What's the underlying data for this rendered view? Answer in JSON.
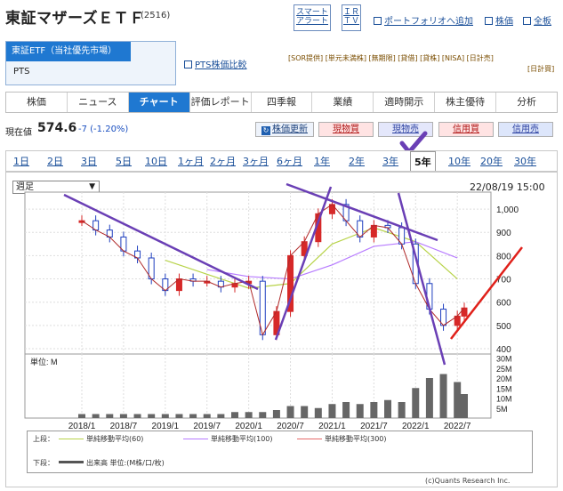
{
  "header": {
    "title": "東証マザーズＥＴＦ",
    "code": "(2516)",
    "smart_alert": "スマート\nアラート",
    "ir_tv": "ＩＲ\nＴＶ",
    "portfolio_link": "ポートフォリオへ追加",
    "stock_price_link": "株価",
    "all_board_link": "全板"
  },
  "market": {
    "selected": "東証ETF（当社優先市場）",
    "pts": "PTS",
    "pts_compare": "PTS株価比較",
    "tags_row1": "[SOR提供] [単元未満株] [無期限] [貸借] [貸株] [NISA] [日計売]",
    "tags_row2": "[日計買]"
  },
  "tabs": [
    "株価",
    "ニュース",
    "チャート",
    "評価レポート",
    "四季報",
    "業績",
    "適時開示",
    "株主優待",
    "分析"
  ],
  "quote": {
    "label": "現在値",
    "price": "574.6",
    "change": "-7 (-1.20%)"
  },
  "actions": {
    "refresh": "株価更新",
    "buy_spot": "現物買",
    "sell_spot": "現物売",
    "buy_margin": "信用買",
    "sell_margin": "信用売"
  },
  "periods": [
    "1日",
    "2日",
    "3日",
    "5日",
    "10日",
    "1ヶ月",
    "2ヶ月",
    "3ヶ月",
    "6ヶ月",
    "1年",
    "2年",
    "3年",
    "5年",
    "10年",
    "20年",
    "30年"
  ],
  "active_period": "5年",
  "chart_controls": {
    "span": "週足",
    "date": "22/08/19 15:00"
  },
  "colors": {
    "accent": "#1f78d1",
    "ma60": "#b8d34a",
    "ma100": "#b77bff",
    "ma300": "#e66a6a",
    "up": "#d62828",
    "down": "#1f3fbf",
    "annotation_purple": "#6a3fb5",
    "annotation_red": "#e0201a"
  },
  "chart_data": {
    "type": "line",
    "x_ticks": [
      "2018/1",
      "2018/7",
      "2019/1",
      "2019/7",
      "2020/1",
      "2020/7",
      "2021/1",
      "2021/7",
      "2022/1",
      "2022/7"
    ],
    "price_ticks": [
      "1,000",
      "900",
      "800",
      "700",
      "600",
      "500",
      "400"
    ],
    "ylim": [
      400,
      1050
    ],
    "volume_ticks": [
      "30M",
      "25M",
      "20M",
      "15M",
      "10M",
      "5M"
    ],
    "volume_unit": "単位: M",
    "price_series": {
      "name": "東証マザーズＥＴＦ",
      "x": [
        "2018/1",
        "2018/3",
        "2018/5",
        "2018/7",
        "2018/9",
        "2018/11",
        "2019/1",
        "2019/3",
        "2019/5",
        "2019/7",
        "2019/9",
        "2019/11",
        "2020/1",
        "2020/3",
        "2020/5",
        "2020/7",
        "2020/9",
        "2020/11",
        "2021/1",
        "2021/3",
        "2021/5",
        "2021/7",
        "2021/9",
        "2021/11",
        "2022/1",
        "2022/3",
        "2022/5",
        "2022/7",
        "2022/8"
      ],
      "values": [
        950,
        910,
        880,
        820,
        790,
        700,
        650,
        700,
        690,
        690,
        665,
        680,
        690,
        460,
        560,
        800,
        860,
        980,
        1020,
        950,
        880,
        930,
        920,
        850,
        680,
        570,
        500,
        540,
        575
      ]
    },
    "ma_lines": [
      {
        "name": "単純移動平均(60)",
        "x": [
          "2019/1",
          "2019/7",
          "2020/1",
          "2020/7",
          "2021/1",
          "2021/7",
          "2022/1",
          "2022/7"
        ],
        "values": [
          780,
          720,
          660,
          680,
          850,
          920,
          860,
          700
        ]
      },
      {
        "name": "単純移動平均(100)",
        "x": [
          "2019/7",
          "2020/1",
          "2020/7",
          "2021/1",
          "2021/7",
          "2022/1",
          "2022/7"
        ],
        "values": [
          740,
          710,
          700,
          760,
          840,
          860,
          790
        ]
      }
    ],
    "volume_values_m": [
      2,
      2,
      2,
      2,
      2,
      2,
      2,
      2,
      2,
      2,
      2,
      3,
      3,
      3,
      4,
      6,
      6,
      5,
      7,
      8,
      7,
      8,
      9,
      8,
      15,
      20,
      22,
      18,
      12
    ],
    "legend_upper_label": "上段：",
    "legend_lower_label": "下段：",
    "legend_upper": [
      "単純移動平均(60)",
      "単純移動平均(100)",
      "単純移動平均(300)"
    ],
    "legend_lower": "出来高 単位:(M株/口/枚)",
    "copyright": "(c)Quants Research Inc."
  }
}
